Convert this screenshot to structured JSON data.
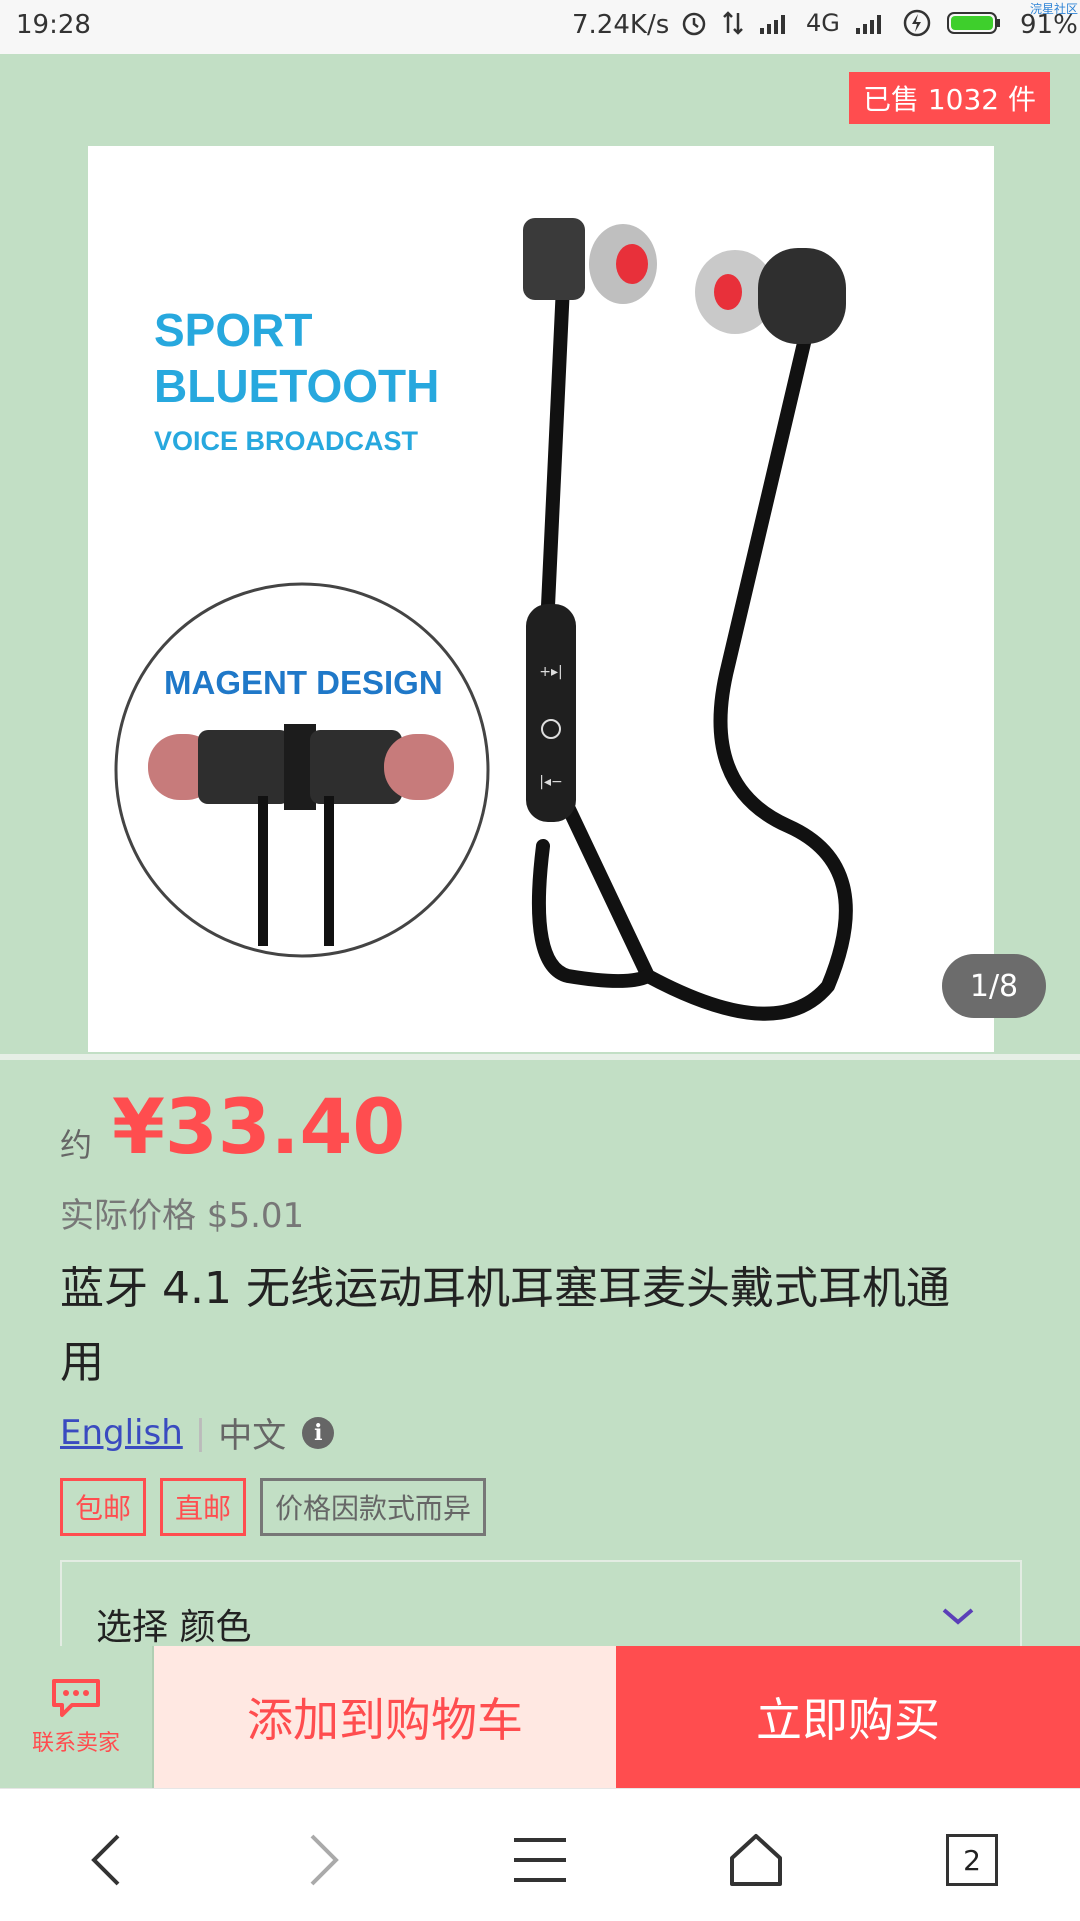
{
  "status": {
    "time": "19:28",
    "speed": "7.24K/s",
    "network": "4G",
    "battery": "91%",
    "corner_tag": "浣星社区"
  },
  "product": {
    "sold": "已售 1032 件",
    "image_counter": "1/8",
    "image_text": {
      "line1": "SPORT",
      "line2": "BLUETOOTH",
      "line3": "VOICE BROADCAST",
      "circle": "MAGENT DESIGN"
    },
    "approx": "约",
    "price": "¥33.40",
    "actual_price": "实际价格 $5.01",
    "title": "蓝牙 4.1 无线运动耳机耳塞耳麦头戴式耳机通用",
    "lang_english": "English",
    "lang_chinese": "中文",
    "tags": [
      "包邮",
      "直邮",
      "价格因款式而异"
    ],
    "select_label": "选择 颜色"
  },
  "actions": {
    "contact": "联系卖家",
    "add_to_cart": "添加到购物车",
    "buy_now": "立即购买"
  },
  "nav": {
    "tab_count": "2"
  }
}
